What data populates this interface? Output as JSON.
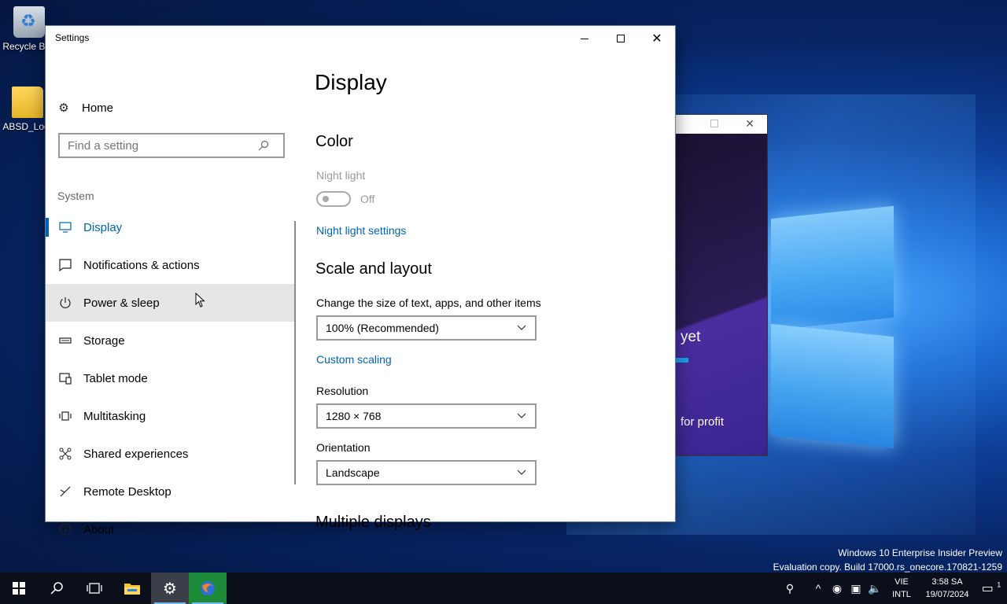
{
  "desktop": {
    "icons": [
      {
        "label": "Recycle Bin",
        "glyph": "recycle-bin-icon"
      },
      {
        "label": "ABSD_Log",
        "glyph": "folder-icon"
      }
    ]
  },
  "background_window": {
    "text1": "yet",
    "text2": "for profit"
  },
  "window": {
    "title": "Settings",
    "controls": {
      "minimize": "minimize-icon",
      "maximize": "maximize-icon",
      "close": "close-icon"
    }
  },
  "nav": {
    "home_label": "Home",
    "search_placeholder": "Find a setting",
    "section": "System",
    "items": [
      {
        "label": "Display",
        "icon": "monitor-icon"
      },
      {
        "label": "Notifications & actions",
        "icon": "notification-icon"
      },
      {
        "label": "Power & sleep",
        "icon": "power-icon"
      },
      {
        "label": "Storage",
        "icon": "storage-icon"
      },
      {
        "label": "Tablet mode",
        "icon": "tablet-mode-icon"
      },
      {
        "label": "Multitasking",
        "icon": "multitasking-icon"
      },
      {
        "label": "Shared experiences",
        "icon": "shared-experiences-icon"
      },
      {
        "label": "Remote Desktop",
        "icon": "remote-desktop-icon"
      },
      {
        "label": "About",
        "icon": "info-icon"
      }
    ]
  },
  "content": {
    "page_title": "Display",
    "color_heading": "Color",
    "night_light_label": "Night light",
    "night_light_state": "Off",
    "night_light_link": "Night light settings",
    "scale_heading": "Scale and layout",
    "scale_label": "Change the size of text, apps, and other items",
    "scale_value": "100% (Recommended)",
    "custom_scaling_link": "Custom scaling",
    "resolution_label": "Resolution",
    "resolution_value": "1280 × 768",
    "orientation_label": "Orientation",
    "orientation_value": "Landscape",
    "multiple_heading": "Multiple displays"
  },
  "watermark": {
    "line1": "Windows 10 Enterprise Insider Preview",
    "line2": "Evaluation copy. Build 17000.rs_onecore.170821-1259"
  },
  "taskbar": {
    "lang_line1": "VIE",
    "lang_line2": "INTL",
    "time": "3:58 SA",
    "date": "19/07/2024",
    "notification_count": "1"
  }
}
